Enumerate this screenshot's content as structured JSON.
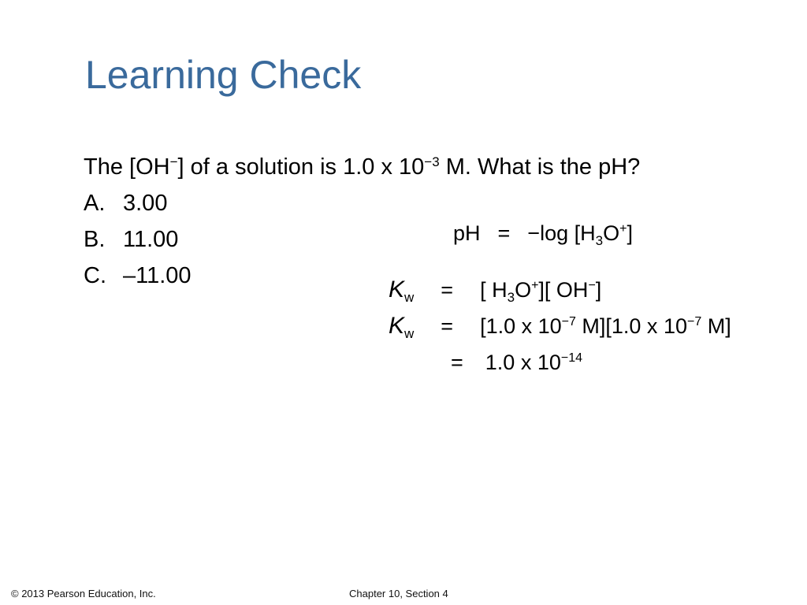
{
  "slide": {
    "title": "Learning Check",
    "question": {
      "prefix": "The [OH",
      "oh_charge": "−",
      "middle": "] of a solution is 1.0 x 10",
      "exponent": "−3",
      "suffix": " M. What is the pH?"
    },
    "options": [
      {
        "label": "A.",
        "value": "3.00"
      },
      {
        "label": "B.",
        "value": "11.00"
      },
      {
        "label": "C.",
        "value": "–11.00"
      }
    ],
    "equations": {
      "ph_def": {
        "lhs": "pH",
        "eq": "=",
        "rhs_a": "−log [H",
        "sub": "3",
        "rhs_b": "O",
        "sup": "+",
        "rhs_c": "]"
      },
      "kw1": {
        "k": "K",
        "k_sub": "w",
        "eq": "=",
        "a": "[ H",
        "sub": "3",
        "b": "O",
        "sup1": "+",
        "c": "][ OH",
        "sup2": "−",
        "d": "]"
      },
      "kw2": {
        "k": "K",
        "k_sub": "w",
        "eq": "=",
        "a": "[1.0 x 10",
        "exp1": "−7",
        "b": " M][1.0 x 10",
        "exp2": "−7",
        "c": " M]"
      },
      "kw3": {
        "eq": "=",
        "a": "1.0 x 10",
        "exp": "−14"
      }
    },
    "footer": {
      "copyright": "© 2013 Pearson Education, Inc.",
      "chapter": "Chapter 10, Section 4"
    }
  }
}
